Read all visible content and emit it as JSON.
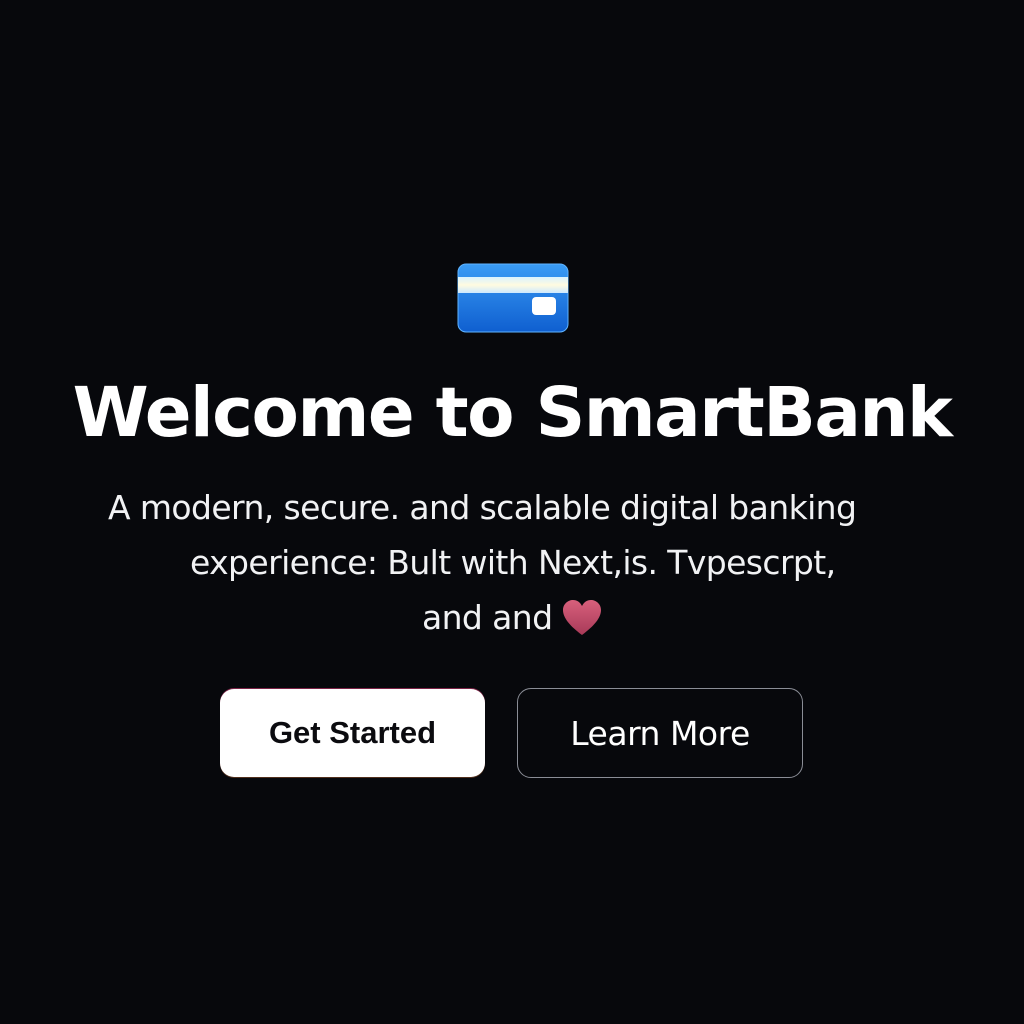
{
  "hero": {
    "icon": "credit-card-icon",
    "title": "Welcome to SmartBank",
    "subtitle": {
      "line1": "A modern, secure. and scalable digital banking",
      "line2": "experience: Bult with Next,is. Tvpescrpt,",
      "line3": "and and",
      "trailing_icon": "heart-icon"
    },
    "buttons": {
      "primary_label": "Get Started",
      "secondary_label": "Learn More"
    }
  },
  "colors": {
    "background": "#07080c",
    "card_blue": "#1e7be6",
    "card_stripe": "#fff6c8",
    "heart": "#c04a68",
    "primary_button_bg": "#ffffff",
    "secondary_button_border": "#8a8d96"
  }
}
